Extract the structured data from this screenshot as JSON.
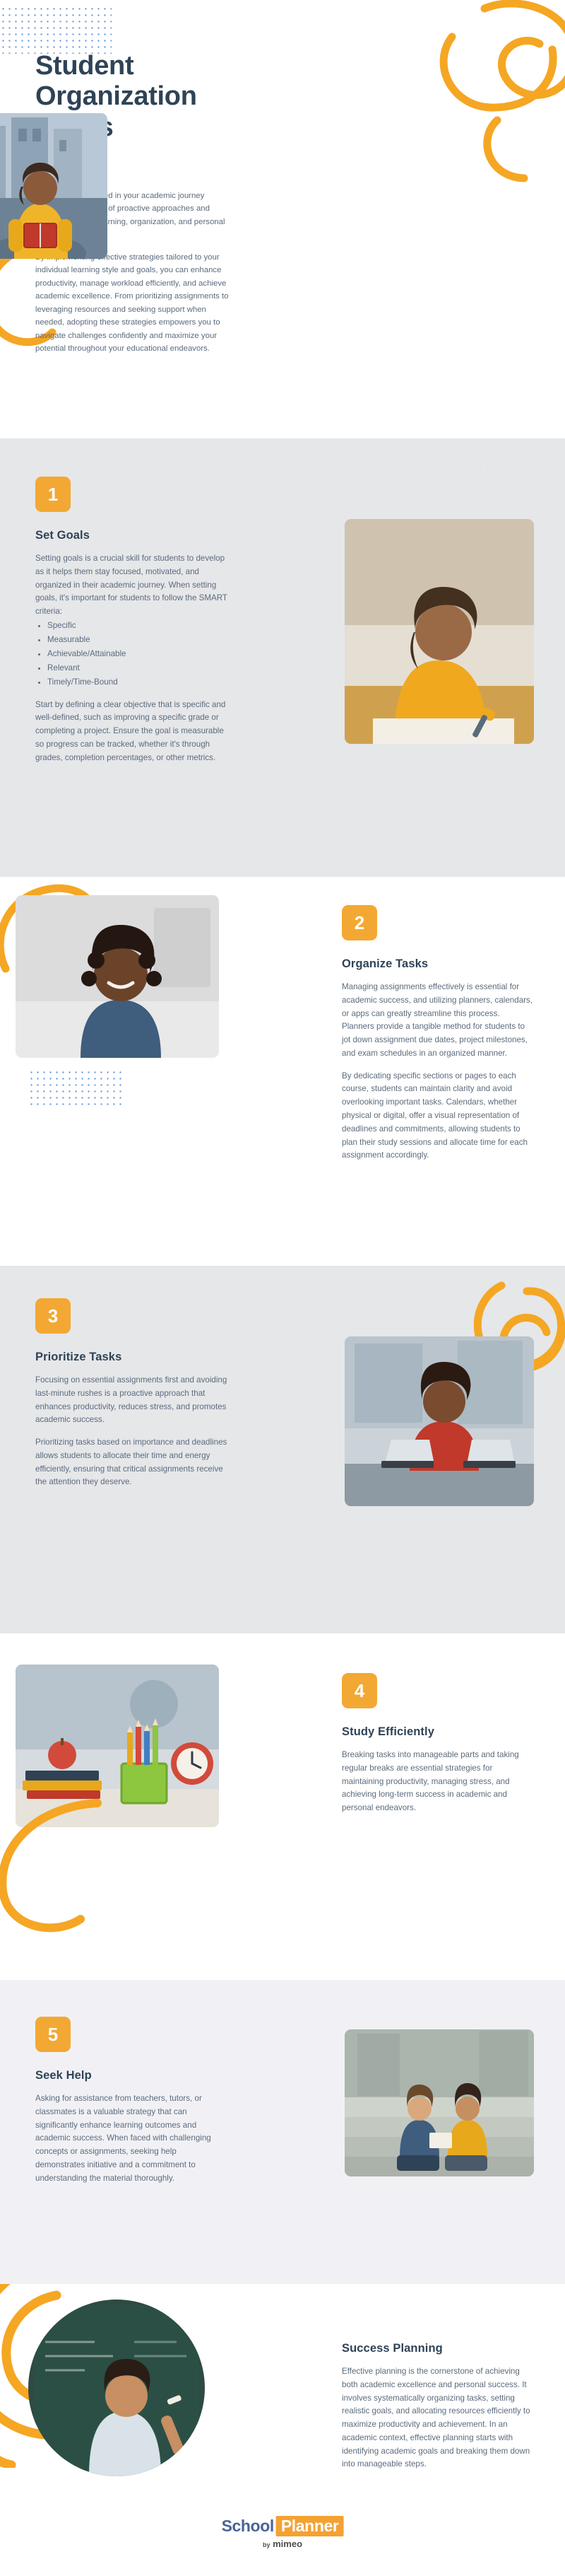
{
  "hero": {
    "title": "Student Organization Hacks",
    "paragraphs": [
      "Strategies to succeed in your academic journey encompass a range of proactive approaches and habits that foster learning, organization, and personal growth.",
      "By implementing effective strategies tailored to your individual learning style and goals, you can enhance productivity, manage workload efficiently, and achieve academic excellence. From prioritizing assignments to leveraging resources and seeking support when needed, adopting these strategies empowers you to navigate challenges confidently and maximize your potential throughout your educational endeavors."
    ]
  },
  "sections": [
    {
      "number": "1",
      "title": "Set Goals",
      "paragraph1": "Setting goals is a crucial skill for students to develop as it helps them stay focused, motivated, and organized in their academic journey. When setting goals, it's important for students to follow the SMART criteria:",
      "bullets": [
        "Specific",
        "Measurable",
        "Achievable/Attainable",
        "Relevant",
        "Timely/Time-Bound"
      ],
      "paragraph2": "Start by defining a clear objective that is specific and well-defined, such as improving a specific grade or completing a project. Ensure the goal is measurable so progress can be tracked, whether it's through grades, completion percentages, or other metrics."
    },
    {
      "number": "2",
      "title": "Organize Tasks",
      "paragraph1": "Managing assignments effectively is essential for academic success, and utilizing planners, calendars, or apps can greatly streamline this process. Planners provide a tangible method for students to jot down assignment due dates, project milestones, and exam schedules in an organized manner.",
      "paragraph2": "By dedicating specific sections or pages to each course, students can maintain clarity and avoid overlooking important tasks. Calendars, whether physical or digital, offer a visual representation of deadlines and commitments, allowing students to plan their study sessions and allocate time for each assignment accordingly."
    },
    {
      "number": "3",
      "title": "Prioritize Tasks",
      "paragraph1": "Focusing on essential assignments first and avoiding last-minute rushes is a proactive approach that enhances productivity, reduces stress, and promotes academic success.",
      "paragraph2": "Prioritizing tasks based on importance and deadlines allows students to allocate their time and energy efficiently, ensuring that critical assignments receive the attention they deserve."
    },
    {
      "number": "4",
      "title": "Study Efficiently",
      "paragraph1": "Breaking tasks into manageable parts and taking regular breaks are essential strategies for maintaining productivity, managing stress, and achieving long-term success in academic and personal endeavors."
    },
    {
      "number": "5",
      "title": "Seek Help",
      "paragraph1": "Asking for assistance from teachers, tutors, or classmates is a valuable strategy that can significantly enhance learning outcomes and academic success. When faced with challenging concepts or assignments, seeking help demonstrates initiative and a commitment to understanding the material thoroughly."
    },
    {
      "number": "",
      "title": "Success Planning",
      "paragraph1": "Effective planning is the cornerstone of achieving both academic excellence and personal success. It involves systematically organizing tasks, setting realistic goals, and allocating resources efficiently to maximize productivity and achievement. In an academic context, effective planning starts with identifying academic goals and breaking them down into manageable steps."
    }
  ],
  "footer": {
    "logo_school": "School",
    "logo_planner": "Planner",
    "logo_by": "by",
    "logo_mimeo": "mimeo"
  },
  "colors": {
    "accent_orange": "#f3a833",
    "heading_navy": "#2f4356",
    "body_text": "#5b6b7d",
    "dot_blue": "#5b8fd4",
    "band_gray": "#e6e7e9",
    "band_lavender": "#f1f1f5"
  }
}
